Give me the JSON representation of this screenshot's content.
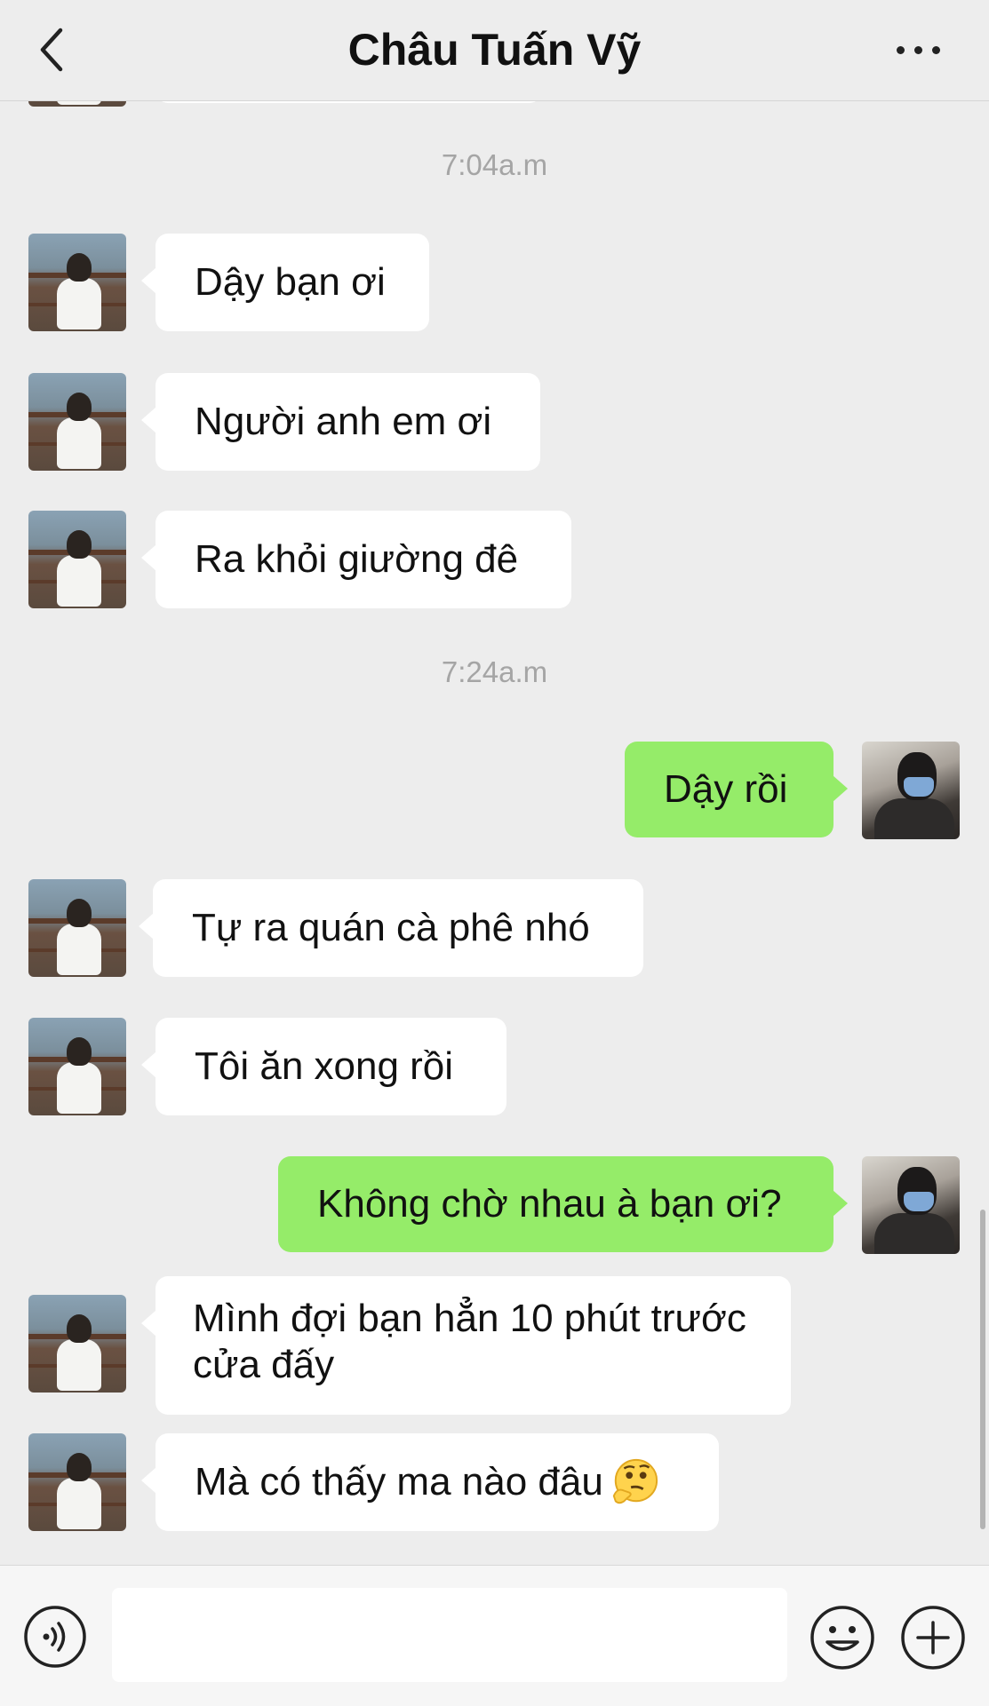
{
  "header": {
    "title": "Châu Tuấn Vỹ",
    "back_icon": "chevron-left-icon",
    "more_icon": "more-horizontal-icon"
  },
  "timestamps": [
    "7:04a.m",
    "7:24a.m"
  ],
  "messages": [
    {
      "from": "friend",
      "text": "Dậy bạn ơi"
    },
    {
      "from": "friend",
      "text": "Người anh em ơi"
    },
    {
      "from": "friend",
      "text": "Ra khỏi giường đê"
    },
    {
      "from": "me",
      "text": "Dậy rồi"
    },
    {
      "from": "friend",
      "text": "Tự ra quán cà phê nhó"
    },
    {
      "from": "friend",
      "text": "Tôi ăn xong rồi"
    },
    {
      "from": "me",
      "text": "Không chờ nhau à bạn ơi?"
    },
    {
      "from": "friend",
      "text": "Mình đợi bạn hẳn 10 phút trước cửa đấy"
    },
    {
      "from": "friend",
      "text": "Mà có thấy ma nào đâu",
      "emoji": "thinking-face-icon"
    }
  ],
  "input": {
    "value": "",
    "voice_icon": "voice-icon",
    "emoji_icon": "smiley-icon",
    "plus_icon": "plus-circle-icon"
  },
  "colors": {
    "background": "#ededed",
    "my_bubble": "#95ec69",
    "friend_bubble": "#ffffff",
    "timestamp": "#a5a5a5"
  }
}
